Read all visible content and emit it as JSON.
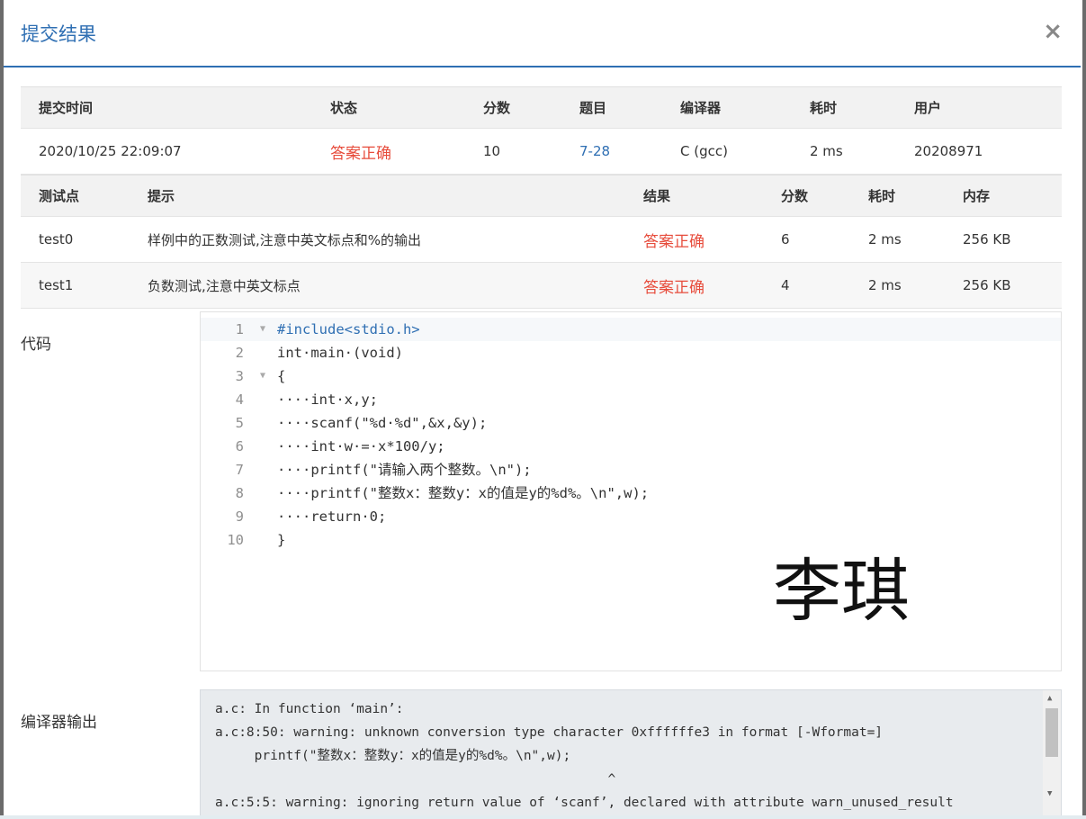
{
  "modal": {
    "title": "提交结果",
    "close_icon": "×"
  },
  "summary": {
    "headers": [
      "提交时间",
      "状态",
      "分数",
      "题目",
      "编译器",
      "耗时",
      "用户"
    ],
    "row": {
      "time": "2020/10/25 22:09:07",
      "status": "答案正确",
      "score": "10",
      "problem": "7-28",
      "compiler": "C (gcc)",
      "duration": "2 ms",
      "user": "20208971"
    }
  },
  "tests": {
    "headers": [
      "测试点",
      "提示",
      "结果",
      "分数",
      "耗时",
      "内存"
    ],
    "rows": [
      {
        "name": "test0",
        "hint": "样例中的正数测试,注意中英文标点和%的输出",
        "result": "答案正确",
        "score": "6",
        "time": "2 ms",
        "memory": "256 KB"
      },
      {
        "name": "test1",
        "hint": "负数测试,注意中英文标点",
        "result": "答案正确",
        "score": "4",
        "time": "2 ms",
        "memory": "256 KB"
      }
    ]
  },
  "code": {
    "label": "代码",
    "lines": [
      "#include<stdio.h>",
      "int·main·(void)",
      "{",
      "····int·x,y;",
      "····scanf(\"%d·%d\",&x,&y);",
      "····int·w·=·x*100/y;",
      "····printf(\"请输入两个整数。\\n\");",
      "····printf(\"整数x：整数y：x的值是y的%d%。\\n\",w);",
      "····return·0;",
      "}"
    ],
    "line_numbers": [
      "1",
      "2",
      "3",
      "4",
      "5",
      "6",
      "7",
      "8",
      "9",
      "10"
    ],
    "watermark": "李琪"
  },
  "output": {
    "label": "编译器输出",
    "lines": [
      "a.c: In function ‘main’:",
      "a.c:8:50: warning: unknown conversion type character 0xffffffe3 in format [-Wformat=]",
      "     printf(\"整数x：整数y：x的值是y的%d%。\\n\",w);",
      "                                                  ^",
      "a.c:5:5: warning: ignoring return value of ‘scanf’, declared with attribute warn_unused_result"
    ]
  },
  "colors": {
    "accent": "#2f6fb3",
    "ok": "#e74c3c"
  }
}
